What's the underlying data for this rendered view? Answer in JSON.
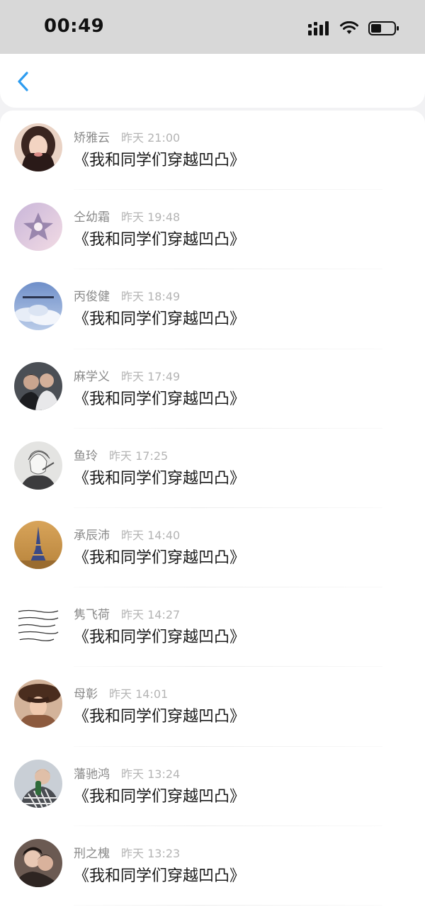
{
  "status_bar": {
    "time": "00:49",
    "icons": [
      "signal-icon",
      "wifi-icon",
      "battery-icon"
    ]
  },
  "header": {
    "back_icon": "chevron-left-icon",
    "accent_color": "#2d9cf0"
  },
  "messages": [
    {
      "name": "矫雅云",
      "time": "昨天 21:00",
      "text": "《我和同学们穿越凹凸》",
      "avatar": "avatar-portrait-girl"
    },
    {
      "name": "仝幼霜",
      "time": "昨天 19:48",
      "text": "《我和同学们穿越凹凸》",
      "avatar": "avatar-star-ornament"
    },
    {
      "name": "丙俊健",
      "time": "昨天 18:49",
      "text": "《我和同学们穿越凹凸》",
      "avatar": "avatar-cloudy-sky"
    },
    {
      "name": "麻学义",
      "time": "昨天 17:49",
      "text": "《我和同学们穿越凹凸》",
      "avatar": "avatar-two-boys"
    },
    {
      "name": "鱼玲",
      "time": "昨天 17:25",
      "text": "《我和同学们穿越凹凸》",
      "avatar": "avatar-anime-sketch"
    },
    {
      "name": "承辰沛",
      "time": "昨天 14:40",
      "text": "《我和同学们穿越凹凸》",
      "avatar": "avatar-eiffel-tower"
    },
    {
      "name": "隽飞荷",
      "time": "昨天 14:27",
      "text": "《我和同学们穿越凹凸》",
      "avatar": "avatar-handwritten-note"
    },
    {
      "name": "母彰",
      "time": "昨天 14:01",
      "text": "《我和同学们穿越凹凸》",
      "avatar": "avatar-woman-hat"
    },
    {
      "name": "藩驰鸿",
      "time": "昨天 13:24",
      "text": "《我和同学们穿越凹凸》",
      "avatar": "avatar-boy-plaid"
    },
    {
      "name": "刑之槐",
      "time": "昨天 13:23",
      "text": "《我和同学们穿越凹凸》",
      "avatar": "avatar-couple"
    }
  ]
}
